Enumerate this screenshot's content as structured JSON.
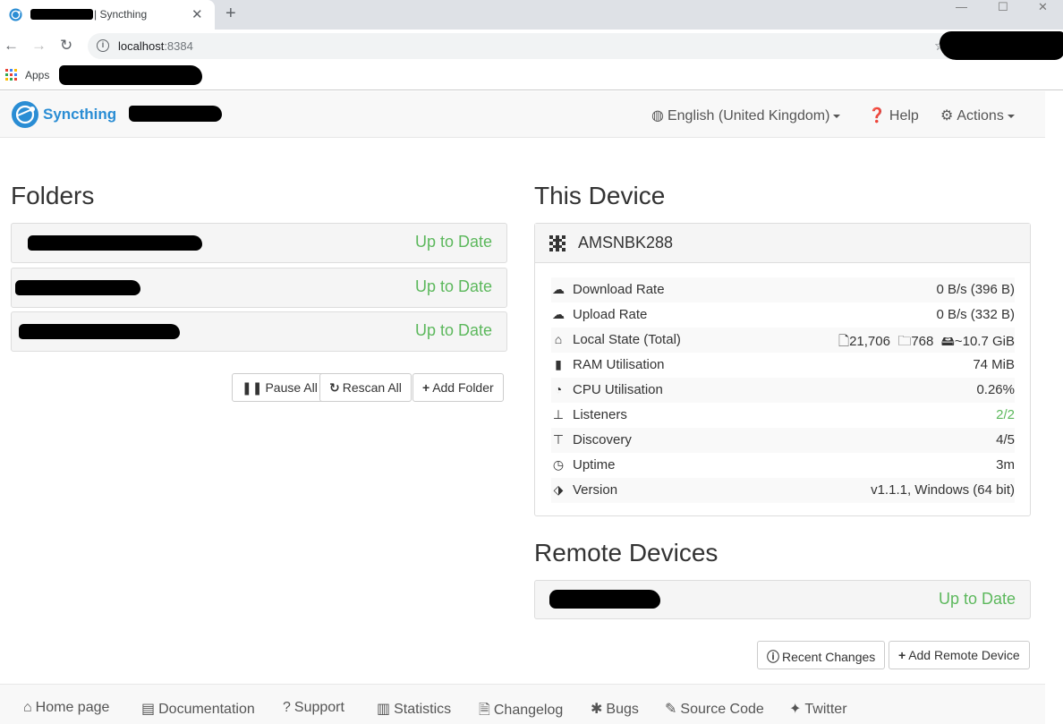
{
  "browser": {
    "tab_title": "| Syncthing",
    "tab_close": "✕",
    "new_tab": "+",
    "url_host": "localhost",
    "url_port": ":8384",
    "bookmarks_apps": "Apps",
    "win_minimize": "—",
    "win_maximize": "☐",
    "win_close": "✕"
  },
  "navbar": {
    "brand": "Syncthing",
    "language": "English (United Kingdom)",
    "help": "Help",
    "actions": "Actions"
  },
  "folders": {
    "title": "Folders",
    "items": [
      {
        "status": "Up to Date"
      },
      {
        "status": "Up to Date"
      },
      {
        "status": "Up to Date"
      }
    ],
    "buttons": {
      "pause_all": "Pause All",
      "rescan_all": "Rescan All",
      "add_folder": "Add Folder"
    }
  },
  "this_device": {
    "title": "This Device",
    "name": "AMSNBK288",
    "stats": {
      "download": {
        "label": "Download Rate",
        "value": "0 B/s (396 B)"
      },
      "upload": {
        "label": "Upload Rate",
        "value": "0 B/s (332 B)"
      },
      "local_state": {
        "label": "Local State (Total)",
        "files": "21,706",
        "dirs": "768",
        "size": "~10.7 GiB"
      },
      "ram": {
        "label": "RAM Utilisation",
        "value": "74 MiB"
      },
      "cpu": {
        "label": "CPU Utilisation",
        "value": "0.26%"
      },
      "listeners": {
        "label": "Listeners",
        "value": "2/2"
      },
      "discovery": {
        "label": "Discovery",
        "value": "4/5"
      },
      "uptime": {
        "label": "Uptime",
        "value": "3m"
      },
      "version": {
        "label": "Version",
        "value": "v1.1.1, Windows (64 bit)"
      }
    }
  },
  "remote_devices": {
    "title": "Remote Devices",
    "items": [
      {
        "status": "Up to Date"
      }
    ],
    "buttons": {
      "recent_changes": "Recent Changes",
      "add_remote": "Add Remote Device"
    }
  },
  "footer": {
    "home": "Home page",
    "docs": "Documentation",
    "support": "Support",
    "stats": "Statistics",
    "changelog": "Changelog",
    "bugs": "Bugs",
    "source": "Source Code",
    "twitter": "Twitter"
  },
  "colors": {
    "accent": "#2a8dd4",
    "success": "#5cb85c",
    "panel": "#f5f5f5"
  }
}
